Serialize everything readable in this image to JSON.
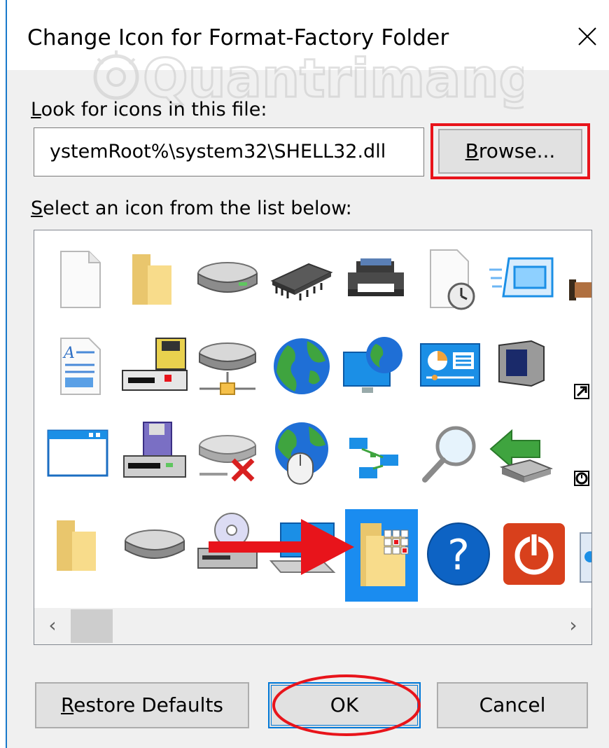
{
  "dialog": {
    "title": "Change Icon for Format-Factory Folder",
    "look_for_label_prefix": "L",
    "look_for_label_rest": "ook for icons in this file:",
    "file_path": "ystemRoot%\\system32\\SHELL32.dll",
    "browse_label_prefix": "B",
    "browse_label_rest": "rowse...",
    "select_label_prefix": "S",
    "select_label_rest": "elect an icon from the list below:",
    "restore_label_prefix": "R",
    "restore_label_rest": "estore Defaults",
    "ok_label": "OK",
    "cancel_label": "Cancel",
    "watermark": "Quantrimang"
  },
  "icons": [
    {
      "name": "blank-document-icon"
    },
    {
      "name": "folder-icon"
    },
    {
      "name": "hard-drive-icon"
    },
    {
      "name": "memory-chip-icon"
    },
    {
      "name": "printer-icon"
    },
    {
      "name": "document-clock-icon"
    },
    {
      "name": "window-stack-icon"
    },
    {
      "name": "partial-icon"
    },
    {
      "name": "text-document-icon"
    },
    {
      "name": "floppy-drive-icon"
    },
    {
      "name": "network-drive-icon"
    },
    {
      "name": "globe-icon"
    },
    {
      "name": "network-computer-icon"
    },
    {
      "name": "control-panel-icon"
    },
    {
      "name": "monitor-moon-icon"
    },
    {
      "name": "shortcut-arrow-icon"
    },
    {
      "name": "application-window-icon"
    },
    {
      "name": "floppy-disk-drive-icon"
    },
    {
      "name": "disconnected-drive-icon"
    },
    {
      "name": "globe-mouse-icon"
    },
    {
      "name": "network-icon"
    },
    {
      "name": "magnifier-icon"
    },
    {
      "name": "usb-arrow-icon"
    },
    {
      "name": "partial-clock-icon"
    },
    {
      "name": "folder-icon"
    },
    {
      "name": "cd-drive-icon"
    },
    {
      "name": "dvd-drive-icon"
    },
    {
      "name": "computer-icon"
    },
    {
      "name": "format-factory-folder-icon",
      "selected": true
    },
    {
      "name": "help-icon"
    },
    {
      "name": "power-icon"
    },
    {
      "name": "recycle-icon"
    }
  ],
  "colors": {
    "accent": "#0078d7",
    "selection": "#1a8cf0",
    "highlight_red": "#e8141b"
  }
}
